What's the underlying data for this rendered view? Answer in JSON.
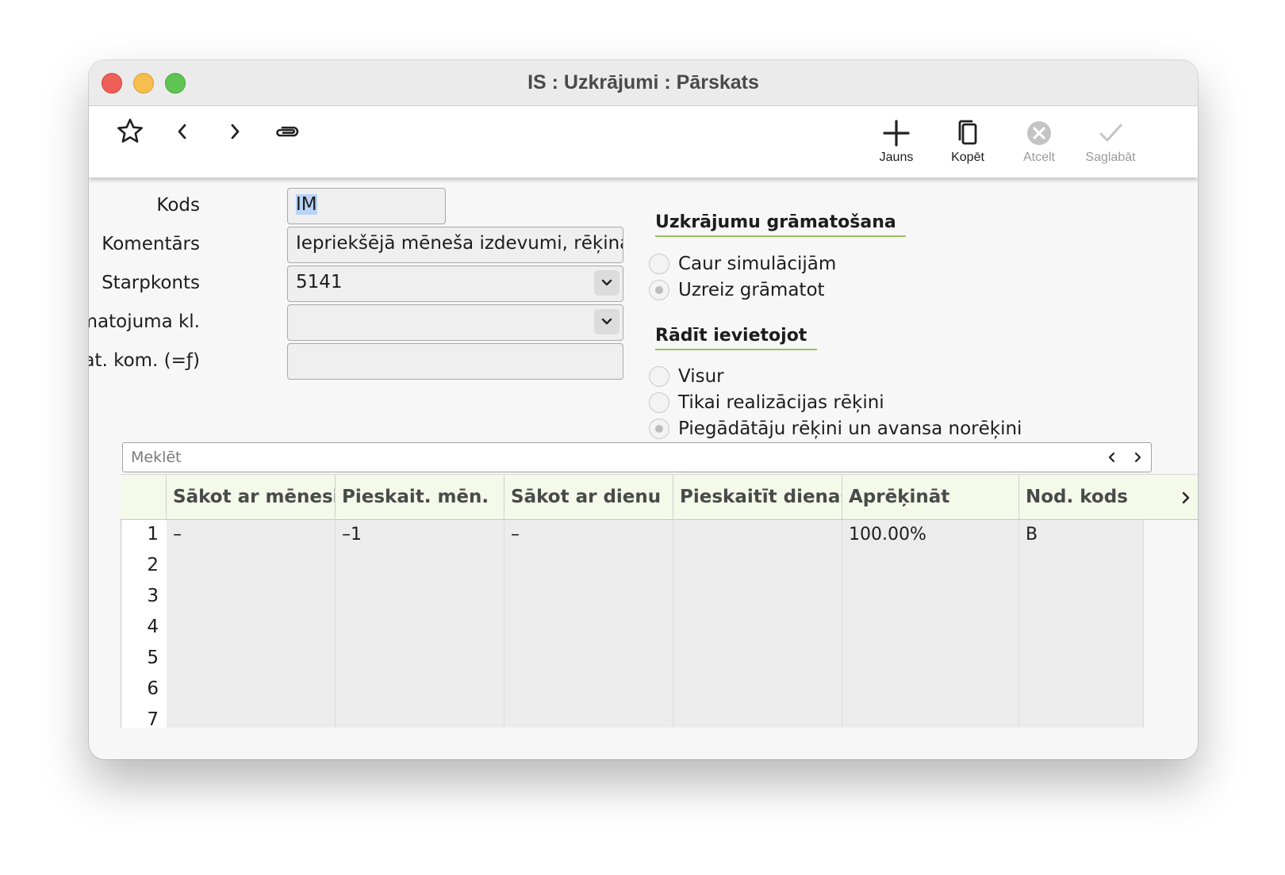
{
  "window": {
    "title": "IS : Uzkrājumi : Pārskats"
  },
  "toolbar": {
    "new_label": "Jauns",
    "copy_label": "Kopēt",
    "cancel_label": "Atcelt",
    "save_label": "Saglabāt"
  },
  "form": {
    "kods": {
      "label": "Kods",
      "value": "IM"
    },
    "komentars": {
      "label": "Komentārs",
      "value": "Iepriekšējā mēneša izdevumi, rēķina"
    },
    "starpkonts": {
      "label": "Starpkonts",
      "value": "5141"
    },
    "gramatojuma_kl": {
      "label": "Grāmatojuma kl.",
      "value": ""
    },
    "gramat_kom": {
      "label": "Grāmat. kom. (=ƒ)",
      "value": ""
    }
  },
  "posting": {
    "title": "Uzkrājumu grāmatošana",
    "options": [
      {
        "label": "Caur simulācijām",
        "selected": false
      },
      {
        "label": "Uzreiz grāmatot",
        "selected": true
      }
    ]
  },
  "show_when": {
    "title": "Rādīt ievietojot",
    "options": [
      {
        "label": "Visur",
        "selected": false
      },
      {
        "label": "Tikai realizācijas rēķini",
        "selected": false
      },
      {
        "label": "Piegādātāju rēķini un avansa norēķini",
        "selected": true
      }
    ]
  },
  "search": {
    "placeholder": "Meklēt"
  },
  "grid": {
    "columns": [
      "Sākot ar mēnesi",
      "Pieskait. mēn.",
      "Sākot ar dienu",
      "Pieskaitīt dienas",
      "Aprēķināt",
      "Nod. kods"
    ],
    "rows": [
      {
        "num": "1",
        "cells": [
          "–",
          "–1",
          "–",
          "",
          "100.00%",
          "B"
        ]
      },
      {
        "num": "2",
        "cells": [
          "",
          "",
          "",
          "",
          "",
          ""
        ]
      },
      {
        "num": "3",
        "cells": [
          "",
          "",
          "",
          "",
          "",
          ""
        ]
      },
      {
        "num": "4",
        "cells": [
          "",
          "",
          "",
          "",
          "",
          ""
        ]
      },
      {
        "num": "5",
        "cells": [
          "",
          "",
          "",
          "",
          "",
          ""
        ]
      },
      {
        "num": "6",
        "cells": [
          "",
          "",
          "",
          "",
          "",
          ""
        ]
      },
      {
        "num": "7",
        "cells": [
          "",
          "",
          "",
          "",
          "",
          ""
        ]
      }
    ]
  },
  "icons": {
    "star": "star-icon",
    "back": "chevron-left-icon",
    "forward": "chevron-right-icon",
    "attach": "paperclip-icon",
    "new": "plus-icon",
    "copy": "copy-icon",
    "cancel": "x-circle-icon",
    "save": "checkmark-icon",
    "dropdown": "chevron-down-icon"
  },
  "colors": {
    "accent_underline": "#9bc15a",
    "header_bg": "#f4f9ea",
    "selection": "#b7d3f5"
  }
}
